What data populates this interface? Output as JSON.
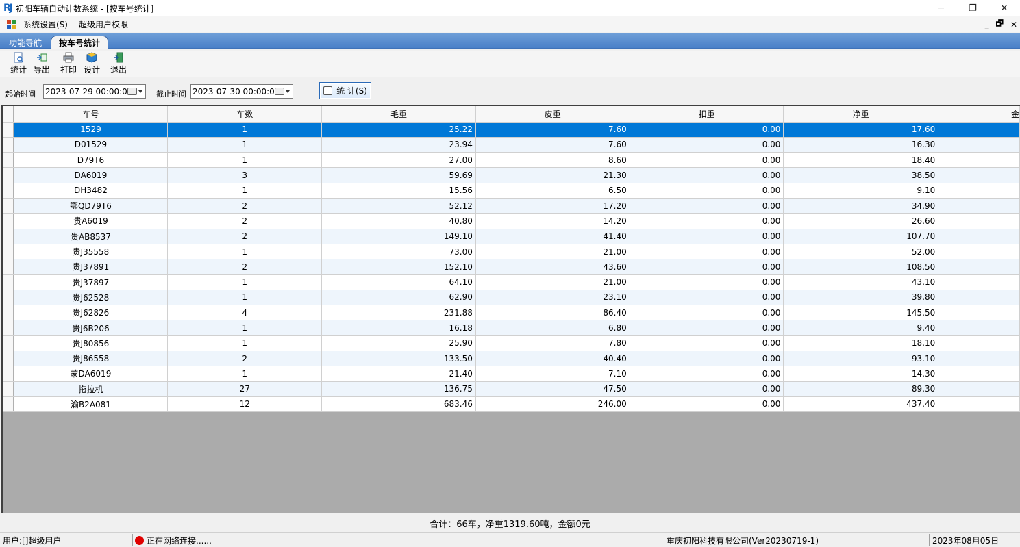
{
  "window": {
    "logo_text": "RJ",
    "title": "初阳车辆自动计数系统 - [按车号统计]",
    "minimize": "─",
    "restore": "❐",
    "close": "✕"
  },
  "menu": {
    "items": [
      "系统设置(S)",
      "超级用户权限"
    ],
    "mdi_controls": [
      "_",
      "🗗",
      "✕"
    ]
  },
  "tabs": {
    "nav": "功能导航",
    "active": "按车号统计"
  },
  "toolbar": {
    "buttons": [
      {
        "label": "统计",
        "icon": "statistics-icon"
      },
      {
        "label": "导出",
        "icon": "export-icon"
      },
      {
        "label": "打印",
        "icon": "printer-icon"
      },
      {
        "label": "设计",
        "icon": "design-icon"
      },
      {
        "label": "退出",
        "icon": "exit-icon"
      }
    ]
  },
  "filter": {
    "start_label": "起始时间",
    "start_value": "2023-07-29 00:00:00",
    "end_label": "截止时间",
    "end_value": "2023-07-30 00:00:00",
    "stat_button": "统 计(S)"
  },
  "table": {
    "columns": [
      "车号",
      "车数",
      "毛重",
      "皮重",
      "扣重",
      "净重",
      "金"
    ],
    "rows": [
      [
        "1529",
        "1",
        "25.22",
        "7.60",
        "0.00",
        "17.60"
      ],
      [
        "D01529",
        "1",
        "23.94",
        "7.60",
        "0.00",
        "16.30"
      ],
      [
        "D79T6",
        "1",
        "27.00",
        "8.60",
        "0.00",
        "18.40"
      ],
      [
        "DA6019",
        "3",
        "59.69",
        "21.30",
        "0.00",
        "38.50"
      ],
      [
        "DH3482",
        "1",
        "15.56",
        "6.50",
        "0.00",
        "9.10"
      ],
      [
        "鄂QD79T6",
        "2",
        "52.12",
        "17.20",
        "0.00",
        "34.90"
      ],
      [
        "贵A6019",
        "2",
        "40.80",
        "14.20",
        "0.00",
        "26.60"
      ],
      [
        "贵AB8537",
        "2",
        "149.10",
        "41.40",
        "0.00",
        "107.70"
      ],
      [
        "贵J35558",
        "1",
        "73.00",
        "21.00",
        "0.00",
        "52.00"
      ],
      [
        "贵J37891",
        "2",
        "152.10",
        "43.60",
        "0.00",
        "108.50"
      ],
      [
        "贵J37897",
        "1",
        "64.10",
        "21.00",
        "0.00",
        "43.10"
      ],
      [
        "贵J62528",
        "1",
        "62.90",
        "23.10",
        "0.00",
        "39.80"
      ],
      [
        "贵J62826",
        "4",
        "231.88",
        "86.40",
        "0.00",
        "145.50"
      ],
      [
        "贵J6B206",
        "1",
        "16.18",
        "6.80",
        "0.00",
        "9.40"
      ],
      [
        "贵J80856",
        "1",
        "25.90",
        "7.80",
        "0.00",
        "18.10"
      ],
      [
        "贵J86558",
        "2",
        "133.50",
        "40.40",
        "0.00",
        "93.10"
      ],
      [
        "蒙DA6019",
        "1",
        "21.40",
        "7.10",
        "0.00",
        "14.30"
      ],
      [
        "拖拉机",
        "27",
        "136.75",
        "47.50",
        "0.00",
        "89.30"
      ],
      [
        "渝B2A081",
        "12",
        "683.46",
        "246.00",
        "0.00",
        "437.40"
      ]
    ],
    "selected_row": 0
  },
  "summary": "合计：66车，净重1319.60吨，金额0元",
  "status": {
    "user": "用户:[]超级用户",
    "network": "正在网络连接......",
    "company": "重庆初阳科技有限公司(Ver20230719-1)",
    "date": "2023年08月05日"
  },
  "colors": {
    "selection": "#0078d7",
    "tab_strip": "#4a80c8",
    "alt_row": "#eef5fc",
    "status_dot": "#e00000"
  }
}
